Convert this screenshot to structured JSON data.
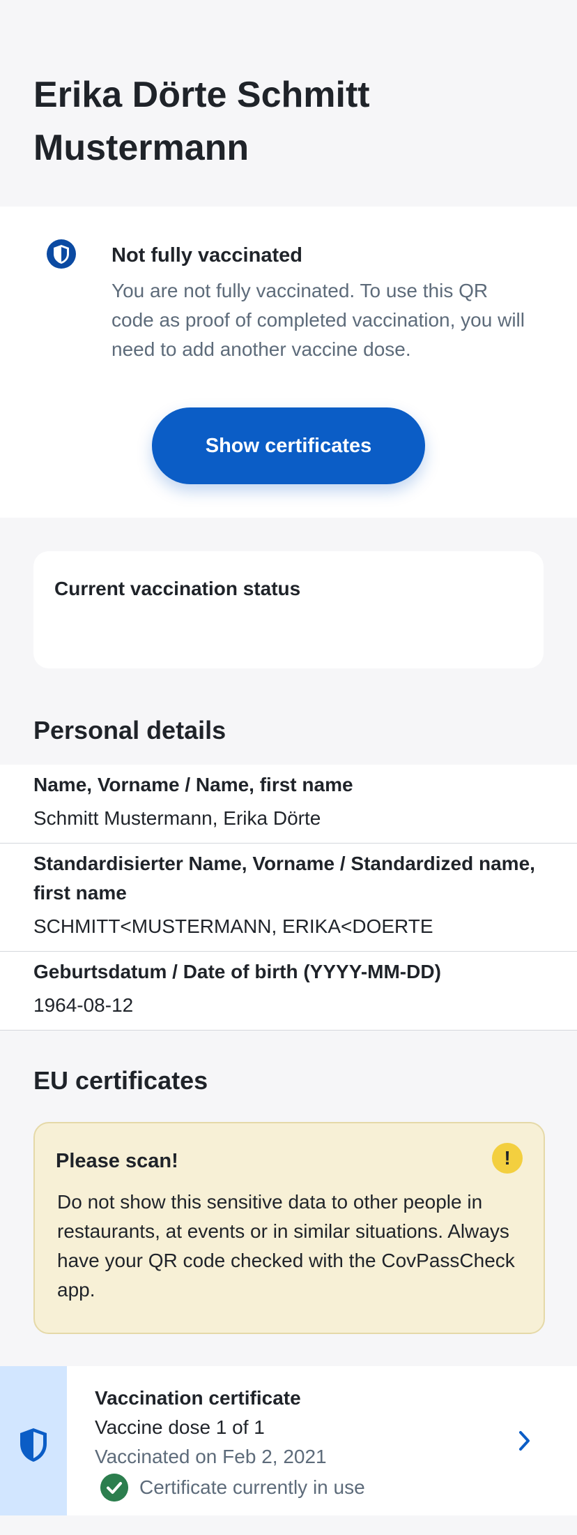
{
  "header": {
    "person_name": "Erika Dörte Schmitt Mustermann"
  },
  "status": {
    "title": "Not fully vaccinated",
    "text": "You are not fully vaccinated. To use this QR code as proof of completed vaccination, you will need to add another vaccine dose.",
    "icon": "shield-icon",
    "button_label": "Show certificates"
  },
  "vaccination_card": {
    "title": "Current vaccination status"
  },
  "personal_details": {
    "title": "Personal details",
    "rows": [
      {
        "label": "Name, Vorname / Name, first name",
        "value": "Schmitt Mustermann, Erika Dörte"
      },
      {
        "label": "Standardisierter Name, Vorname / Standardized name, first name",
        "value": "SCHMITT<MUSTERMANN, ERIKA<DOERTE"
      },
      {
        "label": "Geburtsdatum / Date of birth (YYYY-MM-DD)",
        "value": "1964-08-12"
      }
    ]
  },
  "eu_certificates": {
    "title": "EU certificates",
    "warning": {
      "title": "Please scan!",
      "text": "Do not show this sensitive data to other people in restaurants, at events or in similar situations. Always have your QR code checked with the CovPassCheck app.",
      "icon": "exclamation-icon"
    },
    "certificate": {
      "title": "Vaccination certificate",
      "dose": "Vaccine dose 1 of 1",
      "date": "Vaccinated on Feb 2, 2021",
      "status": "Certificate currently in use",
      "icon": "shield-icon"
    }
  },
  "colors": {
    "primary": "#0b5dc6",
    "warning_bg": "#f7f0d6",
    "warning_icon": "#f3cf3f",
    "success": "#2c7e4e",
    "cert_side": "#d2e6ff"
  }
}
